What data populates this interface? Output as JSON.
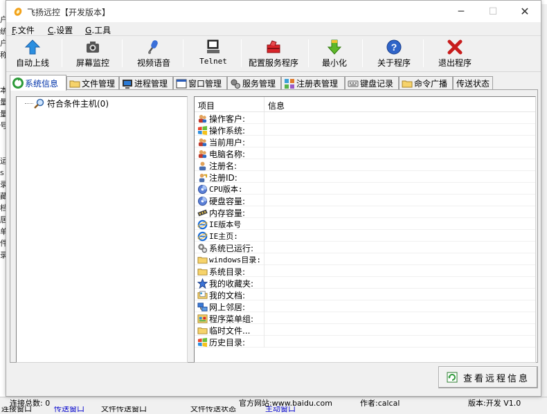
{
  "window": {
    "title": "飞扬远控【开发版本】",
    "controls": {
      "minimize": "─",
      "maximize": "☐",
      "close": "✕"
    }
  },
  "menu": [
    {
      "key": "F",
      "label": ".文件"
    },
    {
      "key": "C",
      "label": ".设置"
    },
    {
      "key": "G",
      "label": ".工具"
    }
  ],
  "toolbar": [
    {
      "label": "自动上线",
      "icon": "up-arrow-icon"
    },
    {
      "label": "屏幕监控",
      "icon": "camera-icon"
    },
    {
      "label": "视频语音",
      "icon": "microphone-icon"
    },
    {
      "label": "Telnet",
      "icon": "computer-icon"
    },
    {
      "label": "配置服务程序",
      "icon": "toolbox-icon"
    },
    {
      "label": "最小化",
      "icon": "down-arrow-icon"
    },
    {
      "label": "关于程序",
      "icon": "help-icon"
    },
    {
      "label": "退出程序",
      "icon": "exit-icon"
    }
  ],
  "tabs": [
    {
      "label": "系统信息",
      "active": true
    },
    {
      "label": "文件管理"
    },
    {
      "label": "进程管理"
    },
    {
      "label": "窗口管理"
    },
    {
      "label": "服务管理"
    },
    {
      "label": "注册表管理"
    },
    {
      "label": "键盘记录"
    },
    {
      "label": "命令广播"
    },
    {
      "label": "传送状态"
    }
  ],
  "tree": {
    "root_label": "符合条件主机(0)"
  },
  "info_table": {
    "columns": [
      "项目",
      "信息"
    ],
    "rows": [
      {
        "label": "操作客户:",
        "icon": "users-icon"
      },
      {
        "label": "操作系统:",
        "icon": "windows-flag-icon"
      },
      {
        "label": "当前用户:",
        "icon": "users-icon"
      },
      {
        "label": "电脑名称:",
        "icon": "users-icon"
      },
      {
        "label": "注册名:",
        "icon": "user-icon"
      },
      {
        "label": "注册ID:",
        "icon": "user-key-icon"
      },
      {
        "label": "CPU版本:",
        "icon": "disk-icon"
      },
      {
        "label": "硬盘容量:",
        "icon": "disk-icon"
      },
      {
        "label": "内存容量:",
        "icon": "memory-icon"
      },
      {
        "label": "IE版本号",
        "icon": "ie-icon"
      },
      {
        "label": "IE主页:",
        "icon": "ie-icon"
      },
      {
        "label": "系统已运行:",
        "icon": "gears-icon"
      },
      {
        "label": "windows目录:",
        "icon": "folder-icon"
      },
      {
        "label": "系统目录:",
        "icon": "folder-icon"
      },
      {
        "label": "我的收藏夹:",
        "icon": "star-icon"
      },
      {
        "label": "我的文档:",
        "icon": "documents-icon"
      },
      {
        "label": "网上邻居:",
        "icon": "network-icon"
      },
      {
        "label": "程序菜单组:",
        "icon": "programs-icon"
      },
      {
        "label": "临时文件...",
        "icon": "folder-icon"
      },
      {
        "label": "历史目录:",
        "icon": "windows-flag-icon"
      }
    ]
  },
  "view_button": {
    "label": "查看远程信息"
  },
  "background": {
    "left_chars": [
      "户",
      "统",
      "户",
      "称",
      "",
      "",
      "本",
      "量",
      "量",
      "号",
      "",
      "",
      "运",
      "s",
      "录",
      "藏",
      "档",
      "居",
      "单",
      "件",
      "录"
    ],
    "status_items": [
      "连接总数: 0",
      "官方网站:www.baidu.com",
      "作者:calcal",
      "版本:开发 V1.0"
    ],
    "bottom_tabs": [
      "连接窗口",
      "传送窗口",
      "文件传送窗口",
      "文件传送状态",
      "主动窗口"
    ]
  },
  "colors": {
    "window_bg": "#f0f0f0",
    "white": "#ffffff",
    "border": "#a0a0a0"
  }
}
